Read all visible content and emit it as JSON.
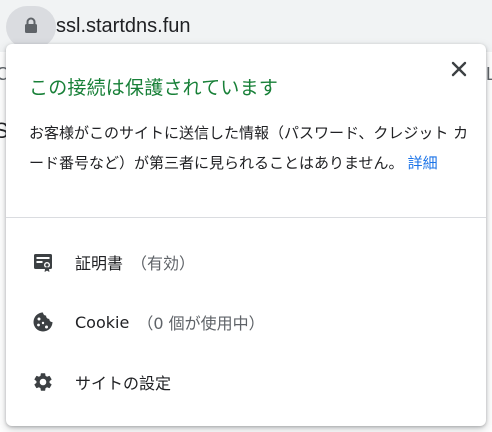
{
  "address_bar": {
    "url": "ssl.startdns.fun",
    "lock_icon": "lock-icon"
  },
  "background_page": {
    "peek_left_1": "C",
    "peek_left_2": "S",
    "peek_right": "L"
  },
  "bubble": {
    "title": "この接続は保護されています",
    "title_color": "#188038",
    "description": "お客様がこのサイトに送信した情報（パスワード、クレジット カード番号など）が第三者に見られることはありません。",
    "details_link": "詳細",
    "link_color": "#1a73e8",
    "close_icon": "close-icon",
    "items": [
      {
        "icon": "certificate-icon",
        "label": "証明書",
        "sub": "（有効）"
      },
      {
        "icon": "cookie-icon",
        "label": "Cookie",
        "sub": "（0 個が使用中）"
      },
      {
        "icon": "gear-icon",
        "label": "サイトの設定",
        "sub": ""
      }
    ]
  }
}
